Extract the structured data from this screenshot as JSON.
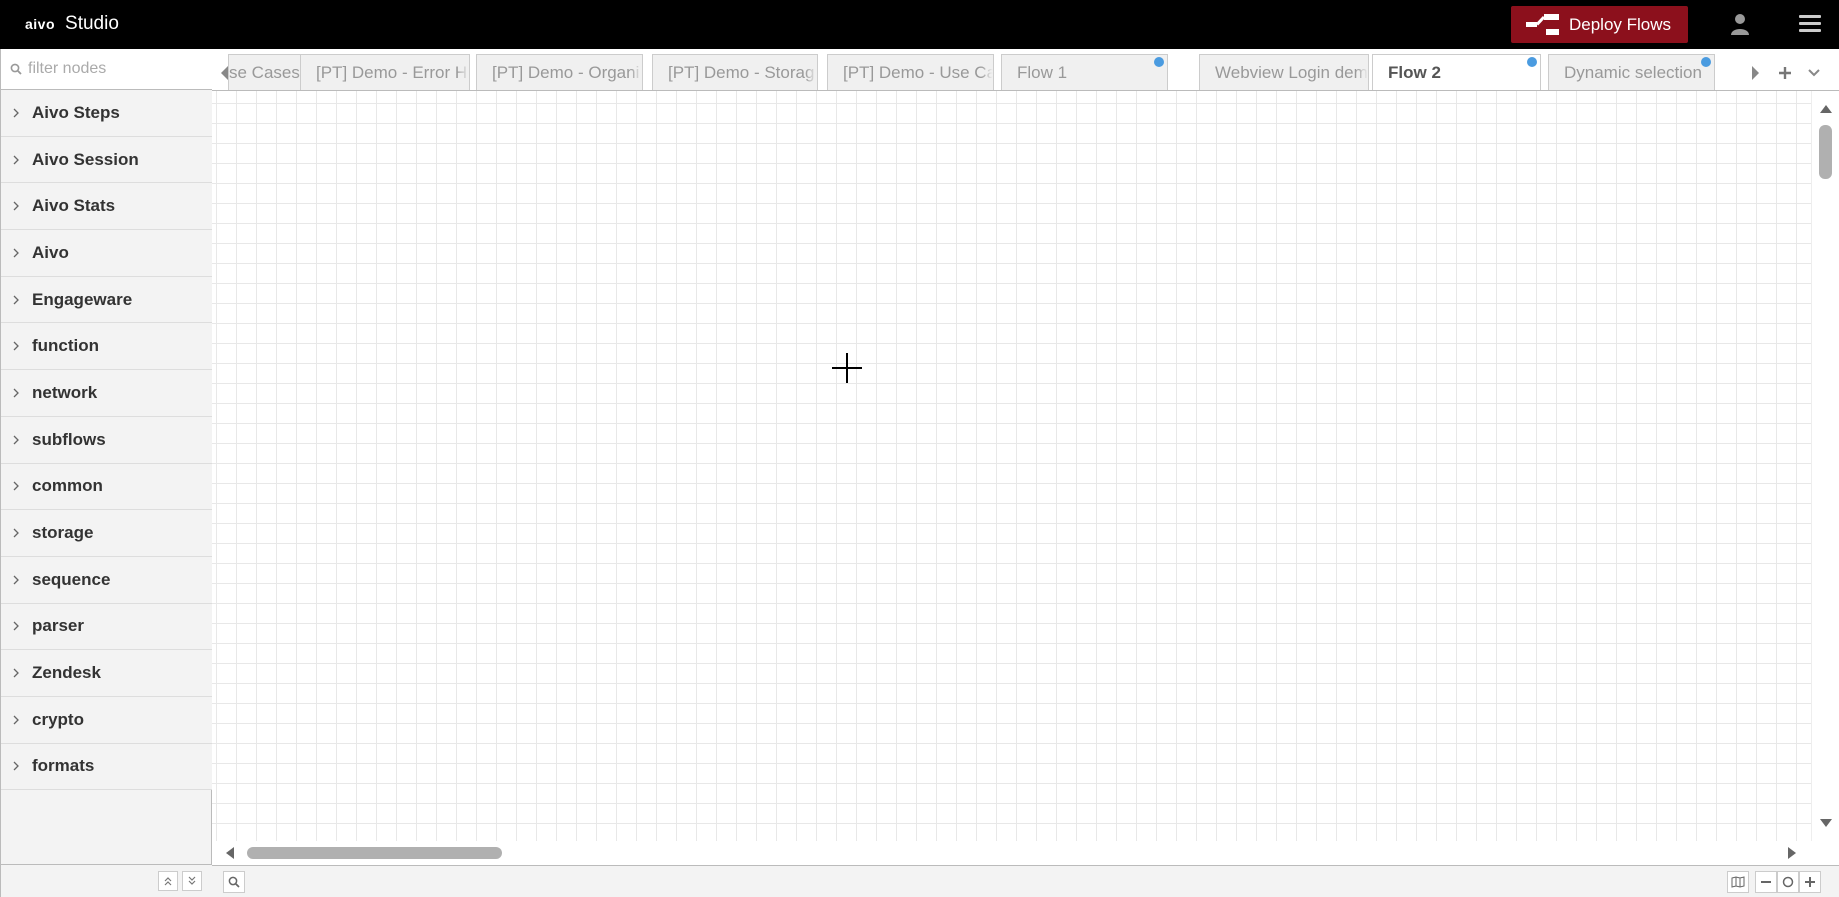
{
  "header": {
    "brand": "aivo",
    "app_name": "Studio",
    "deploy_label": "Deploy Flows",
    "user_icon": "user-icon",
    "menu_icon": "hamburger-menu-icon"
  },
  "palette": {
    "search_placeholder": "filter nodes",
    "categories": [
      {
        "label": "Aivo Steps"
      },
      {
        "label": "Aivo Session"
      },
      {
        "label": "Aivo Stats"
      },
      {
        "label": "Aivo"
      },
      {
        "label": "Engageware"
      },
      {
        "label": "function"
      },
      {
        "label": "network"
      },
      {
        "label": "subflows"
      },
      {
        "label": "common"
      },
      {
        "label": "storage"
      },
      {
        "label": "sequence"
      },
      {
        "label": "parser"
      },
      {
        "label": "Zendesk"
      },
      {
        "label": "crypto"
      },
      {
        "label": "formats"
      }
    ]
  },
  "tabs": [
    {
      "label": "se Cases",
      "changed": false,
      "active": false
    },
    {
      "label": "[PT] Demo - Error H",
      "changed": false,
      "active": false
    },
    {
      "label": "[PT] Demo - Organi",
      "changed": false,
      "active": false
    },
    {
      "label": "[PT] Demo - Storag",
      "changed": false,
      "active": false
    },
    {
      "label": "[PT] Demo - Use Ca",
      "changed": false,
      "active": false
    },
    {
      "label": "Flow 1",
      "changed": true,
      "active": false
    },
    {
      "label": "Webview Login dem",
      "changed": false,
      "active": false
    },
    {
      "label": "Flow 2",
      "changed": true,
      "active": true
    },
    {
      "label": "Dynamic selection",
      "changed": true,
      "active": false
    }
  ],
  "colors": {
    "header_bg": "#000000",
    "deploy_bg": "#8c101c",
    "changed_dot": "#4a9be0"
  }
}
